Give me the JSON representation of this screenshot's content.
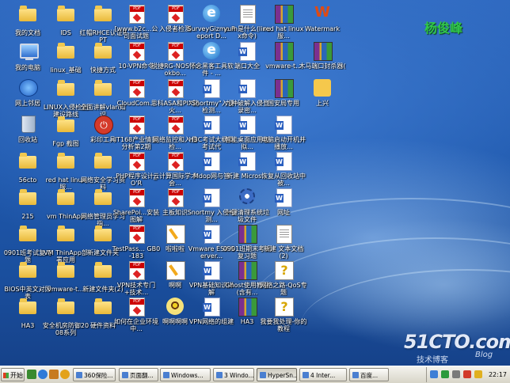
{
  "colors": {
    "brand_name": "#31c64a",
    "taskbar": "#e8e6dc",
    "desktop_top": "#2e68bf",
    "desktop_bottom": "#16428a"
  },
  "brand": {
    "name": "杨俊峰"
  },
  "watermark": {
    "main": "51CTO.com",
    "sub": "技术博客",
    "blog": "Blog"
  },
  "desktop_icons": [
    {
      "label": "我的文档",
      "type": "folder-icon"
    },
    {
      "label": "我的电脑",
      "type": "computer-icon"
    },
    {
      "label": "网上邻居",
      "type": "network-icon"
    },
    {
      "label": "回收站",
      "type": "recycle-bin-icon"
    },
    {
      "label": "56cto",
      "type": "folder-icon"
    },
    {
      "label": "215",
      "type": "folder-icon"
    },
    {
      "label": "0901班考试复习题",
      "type": "folder-icon"
    },
    {
      "label": "BIOS中英文对照表",
      "type": "folder-icon"
    },
    {
      "label": "HA3",
      "type": "folder-icon"
    },
    {
      "label": "IDS",
      "type": "folder-icon"
    },
    {
      "label": "linux_基础",
      "type": "folder-icon"
    },
    {
      "label": "LINUX入侵检测建设路线",
      "type": "folder-icon"
    },
    {
      "label": "Fgp 截图",
      "type": "folder-icon"
    },
    {
      "label": "red hat linux服...",
      "type": "folder-icon"
    },
    {
      "label": "vm ThinApp",
      "type": "folder-icon"
    },
    {
      "label": "VM ThinApp部署应用",
      "type": "folder-icon"
    },
    {
      "label": "vmware-t...",
      "type": "folder-icon"
    },
    {
      "label": "安全机房防御2008系列",
      "type": "folder-icon"
    },
    {
      "label": "红帽RHCE认证PPT",
      "type": "folder-icon"
    },
    {
      "label": "快捷方式",
      "type": "folder-icon"
    },
    {
      "label": "全面讲解vlan知识",
      "type": "folder-icon"
    },
    {
      "label": "彩印工具",
      "type": "power-icon"
    },
    {
      "label": "网络安全学习资料",
      "type": "folder-icon"
    },
    {
      "label": "网络管理员学习指...",
      "type": "folder-icon"
    },
    {
      "label": "新建文件夹",
      "type": "folder-icon"
    },
    {
      "label": "新建文件夹(2)",
      "type": "folder-icon"
    },
    {
      "label": "硬件资料",
      "type": "folder-icon"
    },
    {
      "label": "[www.b2c...公司面试题",
      "type": "pdf-icon"
    },
    {
      "label": "10-VPN命令",
      "type": "pdf-icon"
    },
    {
      "label": "CloudCom...",
      "type": "pdf-icon"
    },
    {
      "label": "IT168产业情报分析第2期",
      "type": "pdf-icon"
    },
    {
      "label": "PHP程序设计_O'R",
      "type": "pdf-icon"
    },
    {
      "label": "SharePoi...安装图解",
      "type": "pdf-icon"
    },
    {
      "label": "TestPass... GB0-183",
      "type": "pdf-icon"
    },
    {
      "label": "VPN技术专门+技术...",
      "type": "pdf-icon"
    },
    {
      "label": "如何在企业环境中...",
      "type": "pdf-icon"
    },
    {
      "label": "入侵者检测",
      "type": "pdf-icon"
    },
    {
      "label": "锐捷RG-NOS cookbo...",
      "type": "pdf-icon"
    },
    {
      "label": "思科ASA和PIX防火...",
      "type": "pdf-icon"
    },
    {
      "label": "网络监控和入侵检...",
      "type": "pdf-icon"
    },
    {
      "label": "云计算国际学术会...",
      "type": "pdf-icon"
    },
    {
      "label": "主板知识",
      "type": "pdf-icon"
    },
    {
      "label": "啦啦啦",
      "type": "paint-icon"
    },
    {
      "label": "啊啊",
      "type": "paint-icon"
    },
    {
      "label": "啊啊啊啊",
      "type": "flower-icon"
    },
    {
      "label": "SurveyGizmo Report D...",
      "type": "internet-explorer-icon"
    },
    {
      "label": "怀念黑客工具软件 - ...",
      "type": "internet-explorer-icon"
    },
    {
      "label": "\"Snortmy\"入侵检测...",
      "type": "word-icon"
    },
    {
      "label": "H3C考试大纲及考试代",
      "type": "word-icon"
    },
    {
      "label": "Mdop网与答",
      "type": "word-icon"
    },
    {
      "label": "Snortmy 入侵检测...",
      "type": "word-icon"
    },
    {
      "label": "Vmware ESX Server...",
      "type": "word-icon"
    },
    {
      "label": "VPN基础知识详解",
      "type": "word-icon"
    },
    {
      "label": "VPN网络的组建",
      "type": "word-icon"
    },
    {
      "label": "yum是什么(linux命令)",
      "type": "document-icon"
    },
    {
      "label": "端口大全",
      "type": "word-icon"
    },
    {
      "label": "九种破解入侵登录密...",
      "type": "word-icon"
    },
    {
      "label": "智能桌面应用虚拟...",
      "type": "word-icon"
    },
    {
      "label": "新建 Micros...",
      "type": "word-icon"
    },
    {
      "label": "一键清理系统垃圾文件",
      "type": "gear-icon"
    },
    {
      "label": "0901班期末考试复习题",
      "type": "rar-icon"
    },
    {
      "label": "Ghost使用教程(含有...",
      "type": "rar-icon"
    },
    {
      "label": "HA3",
      "type": "rar-icon"
    },
    {
      "label": "red hat linux服...",
      "type": "rar-icon"
    },
    {
      "label": "vmware-t...",
      "type": "rar-icon"
    },
    {
      "label": "国安局专用",
      "type": "rar-icon"
    },
    {
      "label": "电脑启动开机并播放...",
      "type": "word-icon"
    },
    {
      "label": "恢复从回收站中被...",
      "type": "word-icon"
    },
    {
      "label": "网址",
      "type": "word-icon"
    },
    {
      "label": "新建 文本文档 (2)",
      "type": "document-icon"
    },
    {
      "label": "网络之路-QoS专题",
      "type": "help-icon"
    },
    {
      "label": "我要我处理-你的教程",
      "type": "help-icon"
    },
    {
      "label": "Watermark",
      "type": "watermark-app-icon"
    },
    {
      "label": "木马端口封杀器(",
      "type": "rar-icon"
    },
    {
      "label": "上兴",
      "type": "shortcut-icon"
    }
  ],
  "taskbar": {
    "start_label": "开始",
    "tasks": [
      {
        "label": "360保险...",
        "active": false
      },
      {
        "label": "页面翻...",
        "active": false
      },
      {
        "label": "Windows...",
        "active": false
      },
      {
        "label": "3 Windo...",
        "active": false
      },
      {
        "label": "HyperSn...",
        "active": true
      },
      {
        "label": "4 Inter...",
        "active": false
      },
      {
        "label": "百度...",
        "active": false
      }
    ],
    "clock": "22:17"
  }
}
